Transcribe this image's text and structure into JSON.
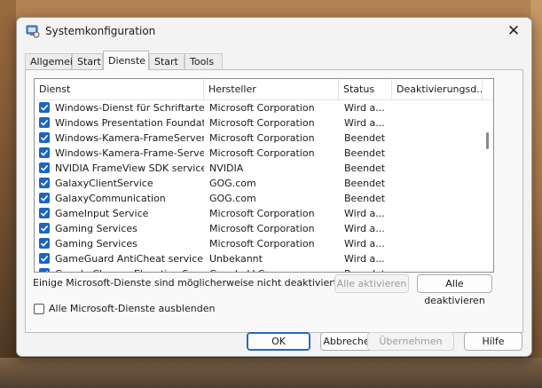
{
  "window": {
    "title": "Systemkonfiguration"
  },
  "tabs": [
    "Allgemein",
    "Start",
    "Dienste",
    "Start",
    "Tools"
  ],
  "active_tab": "Dienste",
  "columns": [
    "Dienst",
    "Hersteller",
    "Status",
    "Deaktivierungsd..."
  ],
  "services": [
    {
      "checked": true,
      "name": "Windows-Dienst für Schriftarten...",
      "vendor": "Microsoft Corporation",
      "status": "Wird a..."
    },
    {
      "checked": true,
      "name": "Windows Presentation Foundati...",
      "vendor": "Microsoft Corporation",
      "status": "Wird a..."
    },
    {
      "checked": true,
      "name": "Windows-Kamera-FrameServer",
      "vendor": "Microsoft Corporation",
      "status": "Beendet"
    },
    {
      "checked": true,
      "name": "Windows-Kamera-Frame-Server...",
      "vendor": "Microsoft Corporation",
      "status": "Beendet"
    },
    {
      "checked": true,
      "name": "NVIDIA FrameView SDK service",
      "vendor": "NVIDIA",
      "status": "Beendet"
    },
    {
      "checked": true,
      "name": "GalaxyClientService",
      "vendor": "GOG.com",
      "status": "Beendet"
    },
    {
      "checked": true,
      "name": "GalaxyCommunication",
      "vendor": "GOG.com",
      "status": "Beendet"
    },
    {
      "checked": true,
      "name": "GameInput Service",
      "vendor": "Microsoft Corporation",
      "status": "Wird a..."
    },
    {
      "checked": true,
      "name": "Gaming Services",
      "vendor": "Microsoft Corporation",
      "status": "Wird a..."
    },
    {
      "checked": true,
      "name": "Gaming Services",
      "vendor": "Microsoft Corporation",
      "status": "Wird a..."
    },
    {
      "checked": true,
      "name": "GameGuard AntiCheat service",
      "vendor": "Unbekannt",
      "status": "Wird a..."
    },
    {
      "checked": true,
      "name": "Google Chrome Elevation Servic...",
      "vendor": "Google LLC",
      "status": "Beendet"
    }
  ],
  "note": "Einige Microsoft-Dienste sind möglicherweise nicht deaktiviert.",
  "buttons": {
    "enable_all": "Alle aktivieren",
    "disable_all": "Alle deaktivieren",
    "ok": "OK",
    "cancel": "Abbrechen",
    "apply": "Übernehmen",
    "help": "Hilfe"
  },
  "hide_ms": {
    "label": "Alle Microsoft-Dienste ausblenden",
    "checked": false
  },
  "colors": {
    "checkbox": "#1a64c4",
    "accent": "#2a66c3"
  }
}
